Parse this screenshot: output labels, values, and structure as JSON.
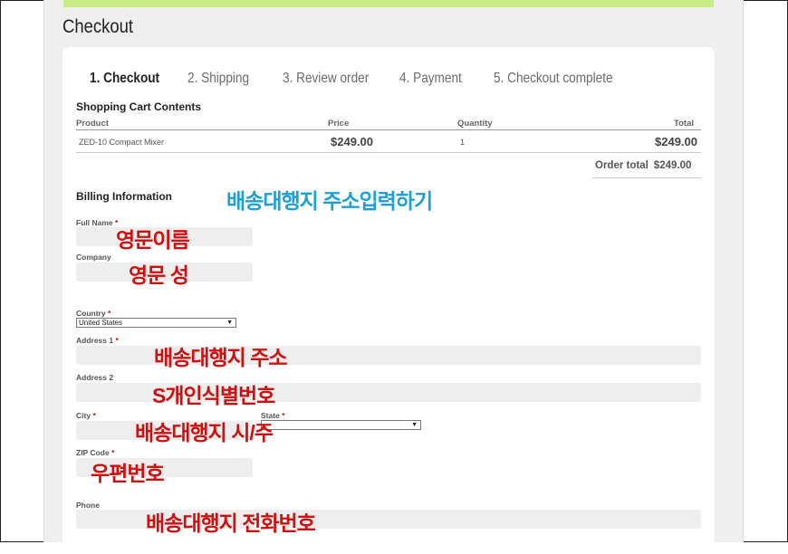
{
  "page_title": "Checkout",
  "steps": [
    "1. Checkout",
    "2. Shipping",
    "3. Review order",
    "4. Payment",
    "5. Checkout complete"
  ],
  "cart": {
    "title": "Shopping Cart Contents",
    "headers": {
      "product": "Product",
      "price": "Price",
      "quantity": "Quantity",
      "total": "Total"
    },
    "rows": [
      {
        "product": "ZED-10 Compact Mixer",
        "price": "$249.00",
        "quantity": "1",
        "total": "$249.00"
      }
    ],
    "order_total_label": "Order total",
    "order_total_value": "$249.00"
  },
  "billing": {
    "title": "Billing Information",
    "full_name_label": "Full Name",
    "company_label": "Company",
    "country_label": "Country",
    "country_value": "United States",
    "address1_label": "Address 1",
    "address2_label": "Address 2",
    "city_label": "City",
    "state_label": "State",
    "zip_label": "ZIP Code",
    "phone_label": "Phone",
    "required_mark": "*"
  },
  "annotations": {
    "header": "배송대행지 주소입력하기",
    "full_name": "영문이름",
    "company": "영문 성",
    "address1": "배송대행지 주소",
    "address2": "S개인식별번호",
    "city_state": "배송대행지 시/주",
    "zip": "우편번호",
    "phone": "배송대행지 전화번호"
  },
  "colors": {
    "accent_bar": "#c9ec86",
    "annotation_red": "#d01010",
    "annotation_blue": "#1e9fd6"
  }
}
